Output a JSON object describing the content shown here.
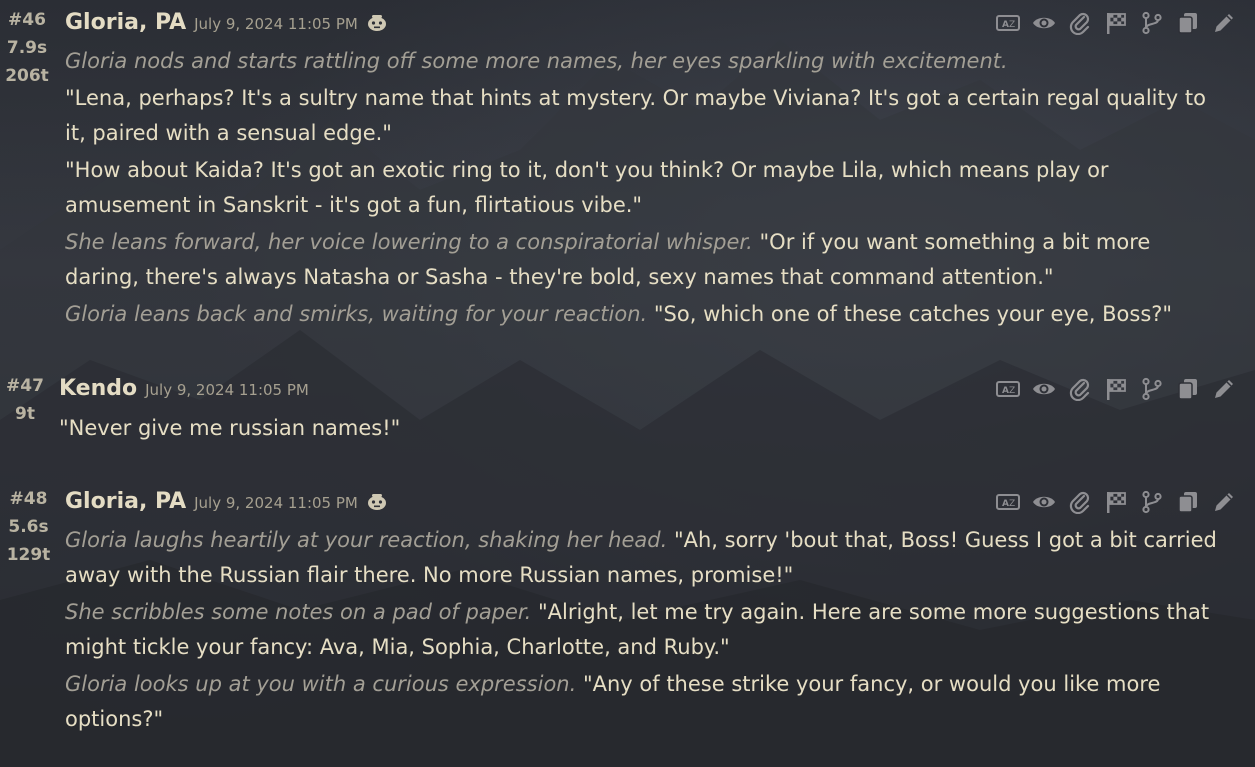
{
  "messages": [
    {
      "number": "#46",
      "time": "7.9s",
      "tokens": "206t",
      "author": "Gloria, PA",
      "timestamp": "July 9, 2024 11:05 PM",
      "is_bot": true,
      "paragraphs": [
        {
          "narration": "Gloria nods and starts rattling off some more names, her eyes sparkling with excitement.",
          "speech": ""
        },
        {
          "narration": "",
          "speech": "\"Lena, perhaps? It's a sultry name that hints at mystery. Or maybe Viviana? It's got a certain regal quality to it, paired with a sensual edge.\""
        },
        {
          "narration": "",
          "speech": "\"How about Kaida? It's got an exotic ring to it, don't you think? Or maybe Lila, which means play or amusement in Sanskrit - it's got a fun, flirtatious vibe.\""
        },
        {
          "narration": "She leans forward, her voice lowering to a conspiratorial whisper.",
          "speech": "\"Or if you want something a bit more daring, there's always Natasha or Sasha - they're bold, sexy names that command attention.\""
        },
        {
          "narration": "Gloria leans back and smirks, waiting for your reaction.",
          "speech": "\"So, which one of these catches your eye, Boss?\""
        }
      ]
    },
    {
      "number": "#47",
      "time": "",
      "tokens": "9t",
      "author": "Kendo",
      "timestamp": "July 9, 2024 11:05 PM",
      "is_bot": false,
      "paragraphs": [
        {
          "narration": "",
          "speech": "\"Never give me russian names!\""
        }
      ]
    },
    {
      "number": "#48",
      "time": "5.6s",
      "tokens": "129t",
      "author": "Gloria, PA",
      "timestamp": "July 9, 2024 11:05 PM",
      "is_bot": true,
      "paragraphs": [
        {
          "narration": "Gloria laughs heartily at your reaction, shaking her head.",
          "speech": "\"Ah, sorry 'bout that, Boss! Guess I got a bit carried away with the Russian flair there. No more Russian names, promise!\""
        },
        {
          "narration": "She scribbles some notes on a pad of paper.",
          "speech": "\"Alright, let me try again. Here are some more suggestions that might tickle your fancy: Ava, Mia, Sophia, Charlotte, and Ruby.\""
        },
        {
          "narration": "Gloria looks up at you with a curious expression.",
          "speech": "\"Any of these strike your fancy, or would you like more options?\""
        }
      ]
    }
  ],
  "toolbar_icons": [
    "translate-icon",
    "eye-icon",
    "paperclip-icon",
    "checkered-flag-icon",
    "branch-icon",
    "copy-icon",
    "pencil-icon"
  ],
  "colors": {
    "background": "#2e3037",
    "text": "#e2dac0",
    "narration": "#a39f95",
    "meta": "#b9b3a2",
    "icon": "#8e8e92"
  }
}
